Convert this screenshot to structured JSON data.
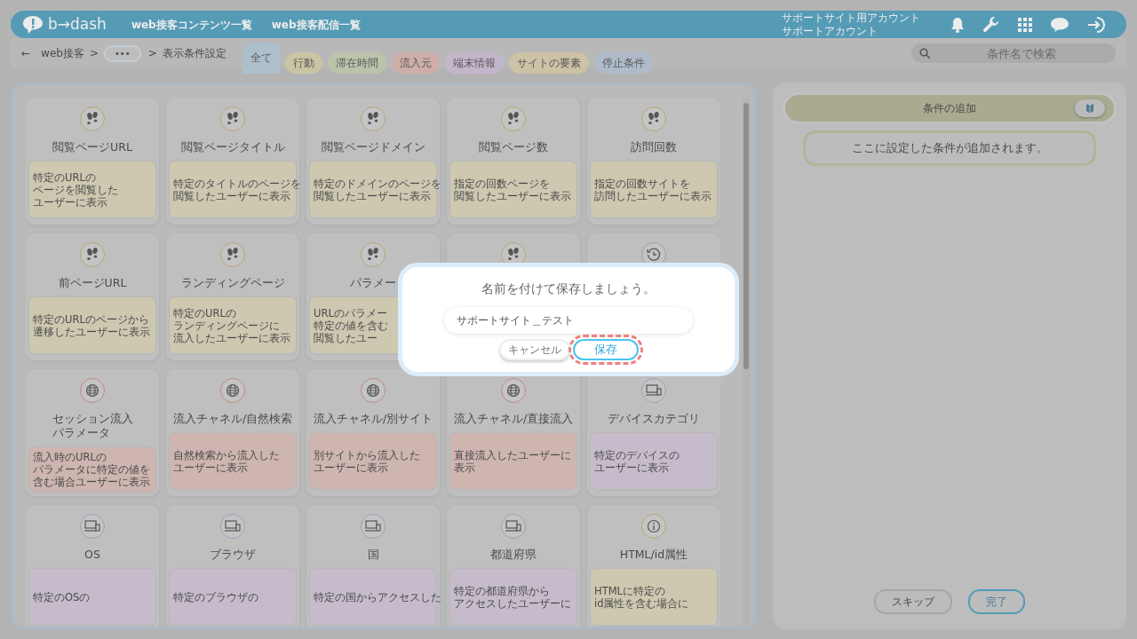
{
  "header": {
    "logo": "b→dash",
    "nav": [
      "web接客コンテンツ一覧",
      "web接客配信一覧"
    ],
    "account": [
      "サポートサイト用アカウント",
      "サポートアカウント"
    ]
  },
  "breadcrumb": {
    "back": "←",
    "items": [
      "web接客",
      ">",
      "•••",
      ">",
      "表示条件設定"
    ]
  },
  "filters": [
    {
      "label": "全て",
      "selected": true,
      "color": "#aebfcc"
    },
    {
      "label": "行動",
      "selected": false,
      "color": "#cbc4a4"
    },
    {
      "label": "滞在時間",
      "selected": false,
      "color": "#bcc3ab"
    },
    {
      "label": "流入元",
      "selected": false,
      "color": "#cfaeaa"
    },
    {
      "label": "端末情報",
      "selected": false,
      "color": "#c4b6ca"
    },
    {
      "label": "サイトの要素",
      "selected": false,
      "color": "#cdc1a6"
    },
    {
      "label": "停止条件",
      "selected": false,
      "color": "#afbbc9"
    }
  ],
  "search": {
    "placeholder": "条件名で検索"
  },
  "conditions": [
    {
      "kind": "footprints",
      "color": "#cec8b1",
      "title": [
        "閲覧ページURL"
      ],
      "description": [
        "特定のURLの",
        "ページを閲覧した",
        "ユーザーに表示"
      ]
    },
    {
      "kind": "footprints",
      "color": "#cec8b1",
      "title": [
        "閲覧ページタイトル"
      ],
      "description": [
        "特定のタイトルのページを",
        "閲覧したユーザーに表示"
      ]
    },
    {
      "kind": "footprints",
      "color": "#cec8b1",
      "title": [
        "閲覧ページドメイン"
      ],
      "description": [
        "特定のドメインのページを",
        "閲覧したユーザーに表示"
      ]
    },
    {
      "kind": "footprints",
      "color": "#cec8b1",
      "title": [
        "閲覧ページ数"
      ],
      "description": [
        "指定の回数ページを",
        "閲覧したユーザーに表示"
      ]
    },
    {
      "kind": "footprints",
      "color": "#cec8b1",
      "title": [
        "訪問回数"
      ],
      "description": [
        "指定の回数サイトを",
        "訪問したユーザーに表示"
      ]
    },
    {
      "kind": "footprints",
      "color": "#cec8b1",
      "title": [
        "前ページURL"
      ],
      "description": [
        "特定のURLのページから",
        "遷移したユーザーに表示"
      ]
    },
    {
      "kind": "footprints",
      "color": "#cec8b1",
      "title": [
        "ランディングページ"
      ],
      "description": [
        "特定のURLの",
        "ランディングページに",
        "流入したユーザーに表示"
      ]
    },
    {
      "kind": "footprints",
      "color": "#cec8b1",
      "title": [
        "パラメー"
      ],
      "description": [
        "URLのパラメー",
        "特定の値を含む",
        "閲覧したユー"
      ]
    },
    {
      "kind": "footprints"
    },
    {
      "kind": "clock"
    },
    {
      "kind": "globe",
      "color": "#ceb5b0",
      "title": [
        "セッション流入",
        "パラメータ"
      ],
      "description": [
        "流入時のURLの",
        "パラメータに特定の値を",
        "含む場合ユーザーに表示"
      ]
    },
    {
      "kind": "globe",
      "color": "#ceb5b0",
      "title": [
        "流入チャネル/自然検索"
      ],
      "description": [
        "自然検索から流入した",
        "ユーザーに表示"
      ]
    },
    {
      "kind": "globe",
      "color": "#ceb5b0",
      "title": [
        "流入チャネル/別サイト"
      ],
      "description": [
        "別サイトから流入した",
        "ユーザーに表示"
      ]
    },
    {
      "kind": "globe",
      "color": "#ceb5b0",
      "title": [
        "流入チャネル/直接流入"
      ],
      "description": [
        "直接流入したユーザーに",
        "表示"
      ]
    },
    {
      "kind": "device",
      "color": "#c6bbcb",
      "title": [
        "デバイスカテゴリ"
      ],
      "description": [
        "特定のデバイスの",
        "ユーザーに表示"
      ]
    },
    {
      "kind": "device",
      "color": "#c6bbcb",
      "title": [
        "OS"
      ],
      "description": [
        "特定のOSの"
      ]
    },
    {
      "kind": "device",
      "color": "#c6bbcb",
      "title": [
        "ブラウザ"
      ],
      "description": [
        "特定のブラウザの"
      ]
    },
    {
      "kind": "device",
      "color": "#c6bbcb",
      "title": [
        "国"
      ],
      "description": [
        "特定の国からアクセスした"
      ]
    },
    {
      "kind": "device",
      "color": "#c6bbcb",
      "title": [
        "都道府県"
      ],
      "description": [
        "特定の都道府県から",
        "アクセスしたユーザーに"
      ]
    },
    {
      "kind": "info",
      "color": "#cec8b1",
      "title": [
        "HTML/id属性"
      ],
      "description": [
        "HTMLに特定の",
        "id属性を含む場合に"
      ]
    }
  ],
  "added": {
    "title": "条件の追加",
    "empty": "ここに設定した条件が追加されます。"
  },
  "footer_buttons": [
    {
      "label": "スキップ",
      "primary": false
    },
    {
      "label": "完了",
      "primary": true
    }
  ],
  "dialog": {
    "title": "名前を付けて保存しましょう。",
    "value": "サポートサイト＿テスト",
    "cancel": "キャンセル",
    "save": "保存",
    "save_focused": true
  }
}
